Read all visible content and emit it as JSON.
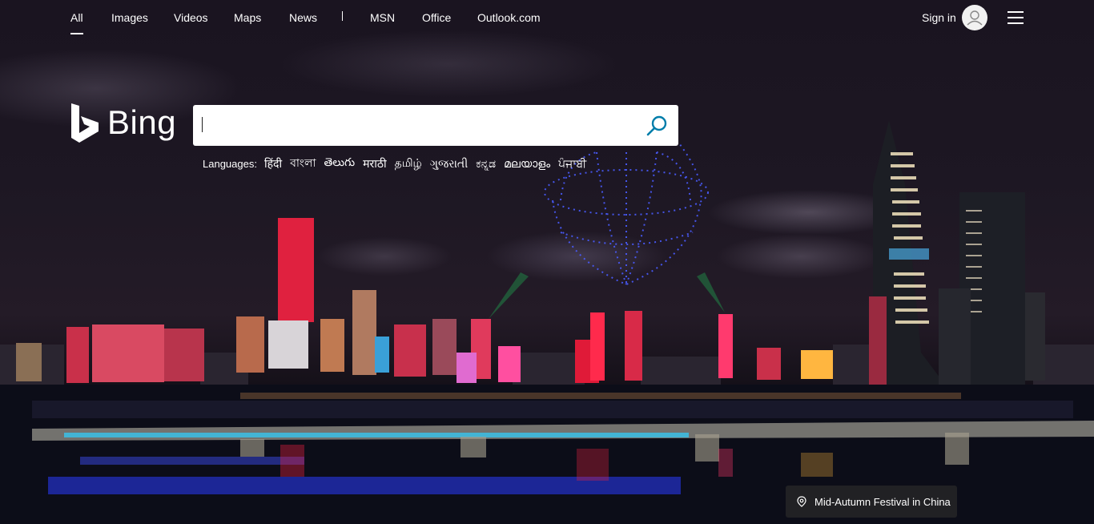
{
  "nav": {
    "items": [
      {
        "label": "All",
        "active": true
      },
      {
        "label": "Images"
      },
      {
        "label": "Videos"
      },
      {
        "label": "Maps"
      },
      {
        "label": "News"
      },
      {
        "label": "MSN"
      },
      {
        "label": "Office"
      },
      {
        "label": "Outlook.com"
      }
    ],
    "sign_in": "Sign in",
    "avatar_icon": "user-icon",
    "menu_icon": "hamburger-menu-icon"
  },
  "logo": {
    "text": "Bing",
    "icon": "bing-logo-icon"
  },
  "search": {
    "value": "",
    "placeholder": "",
    "button_icon": "search-icon"
  },
  "languages": {
    "label": "Languages:",
    "items": [
      "हिंदी",
      "বাংলা",
      "తెలుగు",
      "मराठी",
      "தமிழ்",
      "ગુજરાતી",
      "ಕನ್ನಡ",
      "മലയാളം",
      "ਪੰਜਾਬੀ"
    ]
  },
  "caption": {
    "text": "Mid-Autumn Festival in China",
    "icon": "location-pin-icon"
  },
  "colors": {
    "accent": "#007daa",
    "background": "#1a1420"
  }
}
